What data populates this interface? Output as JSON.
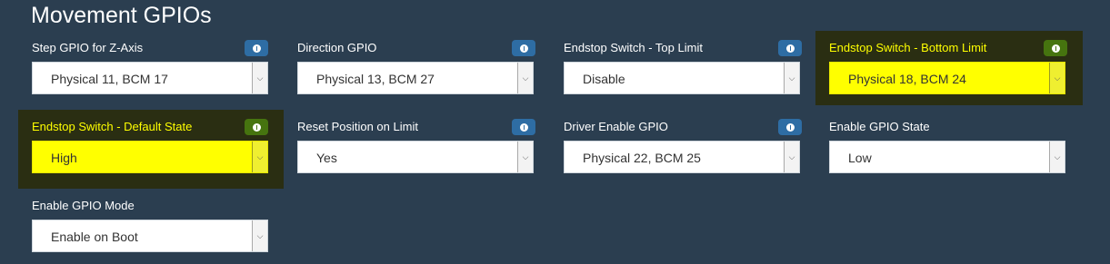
{
  "page": {
    "title": "Movement GPIOs"
  },
  "fields": [
    {
      "label": "Step GPIO for Z-Axis",
      "value": "Physical 11, BCM 17",
      "highlighted": false,
      "has_info": true
    },
    {
      "label": "Direction GPIO",
      "value": "Physical 13, BCM 27",
      "highlighted": false,
      "has_info": true
    },
    {
      "label": "Endstop Switch - Top Limit",
      "value": "Disable",
      "highlighted": false,
      "has_info": true
    },
    {
      "label": "Endstop Switch - Bottom Limit",
      "value": "Physical 18, BCM 24",
      "highlighted": true,
      "has_info": true
    },
    {
      "label": "Endstop Switch - Default State",
      "value": "High",
      "highlighted": true,
      "has_info": true
    },
    {
      "label": "Reset Position on Limit",
      "value": "Yes",
      "highlighted": false,
      "has_info": true
    },
    {
      "label": "Driver Enable GPIO",
      "value": "Physical 22, BCM 25",
      "highlighted": false,
      "has_info": true
    },
    {
      "label": "Enable GPIO State",
      "value": "Low",
      "highlighted": false,
      "has_info": false
    },
    {
      "label": "Enable GPIO Mode",
      "value": "Enable on Boot",
      "highlighted": false,
      "has_info": false
    }
  ],
  "icons": {
    "info": "info-icon",
    "dropdown": "chevron-down-icon"
  },
  "colors": {
    "background": "#2b3e50",
    "highlight": "#ffff00",
    "highlight_panel": "#2a2e12",
    "info_button": "#2e6da4",
    "info_button_highlight": "#46740f"
  }
}
